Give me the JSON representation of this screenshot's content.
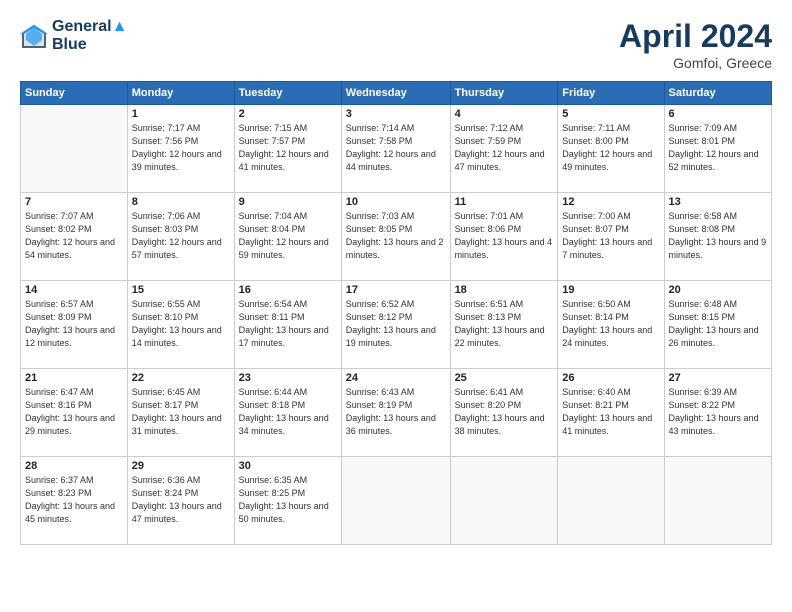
{
  "header": {
    "logo_line1": "General",
    "logo_line2": "Blue",
    "month": "April 2024",
    "location": "Gomfoi, Greece"
  },
  "weekdays": [
    "Sunday",
    "Monday",
    "Tuesday",
    "Wednesday",
    "Thursday",
    "Friday",
    "Saturday"
  ],
  "weeks": [
    [
      {
        "day": "",
        "sunrise": "",
        "sunset": "",
        "daylight": ""
      },
      {
        "day": "1",
        "sunrise": "Sunrise: 7:17 AM",
        "sunset": "Sunset: 7:56 PM",
        "daylight": "Daylight: 12 hours and 39 minutes."
      },
      {
        "day": "2",
        "sunrise": "Sunrise: 7:15 AM",
        "sunset": "Sunset: 7:57 PM",
        "daylight": "Daylight: 12 hours and 41 minutes."
      },
      {
        "day": "3",
        "sunrise": "Sunrise: 7:14 AM",
        "sunset": "Sunset: 7:58 PM",
        "daylight": "Daylight: 12 hours and 44 minutes."
      },
      {
        "day": "4",
        "sunrise": "Sunrise: 7:12 AM",
        "sunset": "Sunset: 7:59 PM",
        "daylight": "Daylight: 12 hours and 47 minutes."
      },
      {
        "day": "5",
        "sunrise": "Sunrise: 7:11 AM",
        "sunset": "Sunset: 8:00 PM",
        "daylight": "Daylight: 12 hours and 49 minutes."
      },
      {
        "day": "6",
        "sunrise": "Sunrise: 7:09 AM",
        "sunset": "Sunset: 8:01 PM",
        "daylight": "Daylight: 12 hours and 52 minutes."
      }
    ],
    [
      {
        "day": "7",
        "sunrise": "Sunrise: 7:07 AM",
        "sunset": "Sunset: 8:02 PM",
        "daylight": "Daylight: 12 hours and 54 minutes."
      },
      {
        "day": "8",
        "sunrise": "Sunrise: 7:06 AM",
        "sunset": "Sunset: 8:03 PM",
        "daylight": "Daylight: 12 hours and 57 minutes."
      },
      {
        "day": "9",
        "sunrise": "Sunrise: 7:04 AM",
        "sunset": "Sunset: 8:04 PM",
        "daylight": "Daylight: 12 hours and 59 minutes."
      },
      {
        "day": "10",
        "sunrise": "Sunrise: 7:03 AM",
        "sunset": "Sunset: 8:05 PM",
        "daylight": "Daylight: 13 hours and 2 minutes."
      },
      {
        "day": "11",
        "sunrise": "Sunrise: 7:01 AM",
        "sunset": "Sunset: 8:06 PM",
        "daylight": "Daylight: 13 hours and 4 minutes."
      },
      {
        "day": "12",
        "sunrise": "Sunrise: 7:00 AM",
        "sunset": "Sunset: 8:07 PM",
        "daylight": "Daylight: 13 hours and 7 minutes."
      },
      {
        "day": "13",
        "sunrise": "Sunrise: 6:58 AM",
        "sunset": "Sunset: 8:08 PM",
        "daylight": "Daylight: 13 hours and 9 minutes."
      }
    ],
    [
      {
        "day": "14",
        "sunrise": "Sunrise: 6:57 AM",
        "sunset": "Sunset: 8:09 PM",
        "daylight": "Daylight: 13 hours and 12 minutes."
      },
      {
        "day": "15",
        "sunrise": "Sunrise: 6:55 AM",
        "sunset": "Sunset: 8:10 PM",
        "daylight": "Daylight: 13 hours and 14 minutes."
      },
      {
        "day": "16",
        "sunrise": "Sunrise: 6:54 AM",
        "sunset": "Sunset: 8:11 PM",
        "daylight": "Daylight: 13 hours and 17 minutes."
      },
      {
        "day": "17",
        "sunrise": "Sunrise: 6:52 AM",
        "sunset": "Sunset: 8:12 PM",
        "daylight": "Daylight: 13 hours and 19 minutes."
      },
      {
        "day": "18",
        "sunrise": "Sunrise: 6:51 AM",
        "sunset": "Sunset: 8:13 PM",
        "daylight": "Daylight: 13 hours and 22 minutes."
      },
      {
        "day": "19",
        "sunrise": "Sunrise: 6:50 AM",
        "sunset": "Sunset: 8:14 PM",
        "daylight": "Daylight: 13 hours and 24 minutes."
      },
      {
        "day": "20",
        "sunrise": "Sunrise: 6:48 AM",
        "sunset": "Sunset: 8:15 PM",
        "daylight": "Daylight: 13 hours and 26 minutes."
      }
    ],
    [
      {
        "day": "21",
        "sunrise": "Sunrise: 6:47 AM",
        "sunset": "Sunset: 8:16 PM",
        "daylight": "Daylight: 13 hours and 29 minutes."
      },
      {
        "day": "22",
        "sunrise": "Sunrise: 6:45 AM",
        "sunset": "Sunset: 8:17 PM",
        "daylight": "Daylight: 13 hours and 31 minutes."
      },
      {
        "day": "23",
        "sunrise": "Sunrise: 6:44 AM",
        "sunset": "Sunset: 8:18 PM",
        "daylight": "Daylight: 13 hours and 34 minutes."
      },
      {
        "day": "24",
        "sunrise": "Sunrise: 6:43 AM",
        "sunset": "Sunset: 8:19 PM",
        "daylight": "Daylight: 13 hours and 36 minutes."
      },
      {
        "day": "25",
        "sunrise": "Sunrise: 6:41 AM",
        "sunset": "Sunset: 8:20 PM",
        "daylight": "Daylight: 13 hours and 38 minutes."
      },
      {
        "day": "26",
        "sunrise": "Sunrise: 6:40 AM",
        "sunset": "Sunset: 8:21 PM",
        "daylight": "Daylight: 13 hours and 41 minutes."
      },
      {
        "day": "27",
        "sunrise": "Sunrise: 6:39 AM",
        "sunset": "Sunset: 8:22 PM",
        "daylight": "Daylight: 13 hours and 43 minutes."
      }
    ],
    [
      {
        "day": "28",
        "sunrise": "Sunrise: 6:37 AM",
        "sunset": "Sunset: 8:23 PM",
        "daylight": "Daylight: 13 hours and 45 minutes."
      },
      {
        "day": "29",
        "sunrise": "Sunrise: 6:36 AM",
        "sunset": "Sunset: 8:24 PM",
        "daylight": "Daylight: 13 hours and 47 minutes."
      },
      {
        "day": "30",
        "sunrise": "Sunrise: 6:35 AM",
        "sunset": "Sunset: 8:25 PM",
        "daylight": "Daylight: 13 hours and 50 minutes."
      },
      {
        "day": "",
        "sunrise": "",
        "sunset": "",
        "daylight": ""
      },
      {
        "day": "",
        "sunrise": "",
        "sunset": "",
        "daylight": ""
      },
      {
        "day": "",
        "sunrise": "",
        "sunset": "",
        "daylight": ""
      },
      {
        "day": "",
        "sunrise": "",
        "sunset": "",
        "daylight": ""
      }
    ]
  ]
}
